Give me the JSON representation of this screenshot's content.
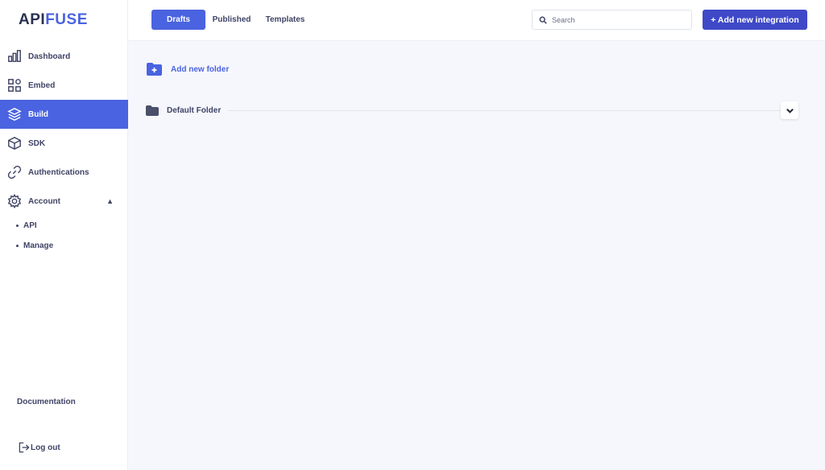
{
  "logo": {
    "part1": "API",
    "part2": "FUSE"
  },
  "sidebar": {
    "items": [
      {
        "label": "Dashboard",
        "icon": "chart-icon"
      },
      {
        "label": "Embed",
        "icon": "apps-icon"
      },
      {
        "label": "Build",
        "icon": "layers-icon"
      },
      {
        "label": "SDK",
        "icon": "box-icon"
      },
      {
        "label": "Authentications",
        "icon": "link-icon"
      },
      {
        "label": "Account",
        "icon": "gear-icon"
      }
    ],
    "account_sub": [
      "API",
      "Manage"
    ],
    "documentation": "Documentation",
    "logout": "Log out"
  },
  "tabs": [
    "Drafts",
    "Published",
    "Templates"
  ],
  "search": {
    "placeholder": "Search"
  },
  "add_integration": "+ Add new integration",
  "main": {
    "add_folder": "Add new folder",
    "folder_name": "Default Folder"
  },
  "colors": {
    "accent": "#4a63e0",
    "button": "#3f49c8",
    "text": "#3f4466",
    "background": "#f6f7fc"
  }
}
